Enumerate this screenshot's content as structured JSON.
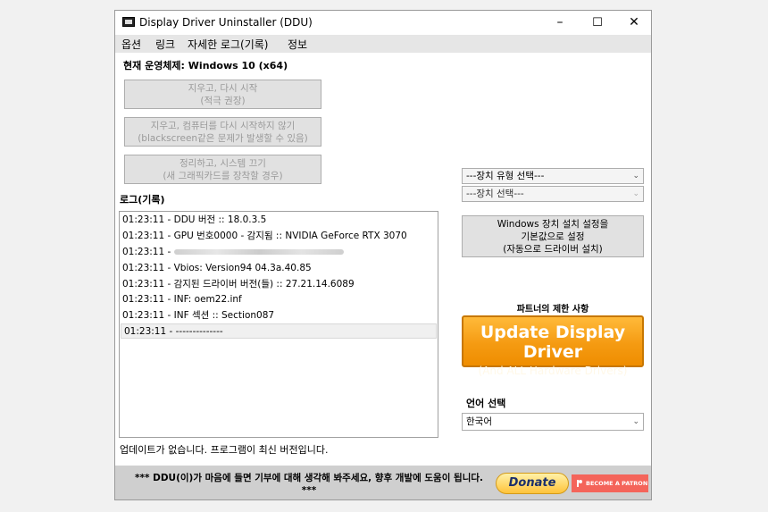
{
  "window": {
    "title": "Display Driver Uninstaller (DDU)",
    "minimize": "–",
    "maximize": "☐",
    "close": "✕"
  },
  "menu": [
    "옵션",
    "링크",
    "자세한 로그(기록)",
    "정보"
  ],
  "os": {
    "label": "현재 운영체제:",
    "value": "Windows 10 (x64)"
  },
  "actions": [
    {
      "line1": "지우고, 다시 시작",
      "line2": "(적극 권장)"
    },
    {
      "line1": "지우고, 컴퓨터를 다시 시작하지 않기",
      "line2": "(blackscreen같은 문제가 발생할 수 있음)"
    },
    {
      "line1": "정리하고, 시스템 끄기",
      "line2": "(새 그래픽카드를 장착할 경우)"
    }
  ],
  "log": {
    "title": "로그(기록)",
    "rows": [
      "01:23:11 - DDU 버전 :: 18.0.3.5",
      "01:23:11 - GPU 번호0000 - 감지됨 :: NVIDIA GeForce RTX 3070",
      "01:23:11 -",
      "01:23:11 - Vbios: Version94 04.3a.40.85",
      "01:23:11 - 감지된 드라이버 버전(들) :: 27.21.14.6089",
      "01:23:11 - INF: oem22.inf",
      "01:23:11 - INF 섹션 :: Section087",
      "01:23:11 - --------------"
    ]
  },
  "status": "업데이트가 없습니다. 프로그램이 최신 버전입니다.",
  "device_type_select": "---장치 유형 선택---",
  "device_select": "---장치 선택---",
  "windows_settings_button": {
    "line1": "Windows 장치 설치 설정을",
    "line2": "기본값으로 설정",
    "line3": "(자동으로 드라이버 설치)"
  },
  "partner": {
    "label": "파트너의 제한 사항",
    "banner_line1": "Update Display Driver",
    "banner_line2": "(And ALL Hardware Drivers)"
  },
  "language": {
    "label": "언어 선택",
    "value": "한국어"
  },
  "footer": {
    "text_line1": "*** DDU(이)가 마음에 들면 기부에 대해 생각해 봐주세요, 향후 개발에 도움이 됩니다.",
    "text_line2": "***",
    "donate": "Donate",
    "patreon": "BECOME A PATRON"
  }
}
